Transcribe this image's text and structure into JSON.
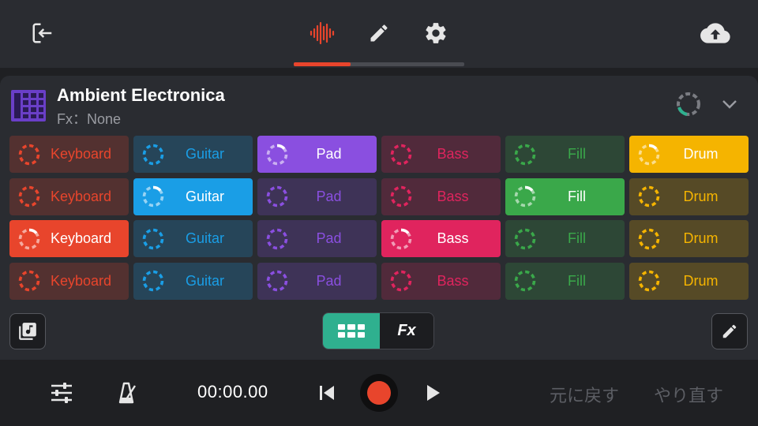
{
  "colors": {
    "accent": "#e8452c",
    "teal": "#2fb08f",
    "purple": "#6a3fc8"
  },
  "icons": {
    "exit": "exit-icon",
    "waveform": "waveform-icon",
    "edit_tab": "pencil-icon",
    "settings": "gear-icon",
    "upload": "cloud-upload-icon",
    "song": "grid-song-icon",
    "loop_status": "loop-progress-icon",
    "collapse": "chevron-down-icon",
    "library": "music-library-icon",
    "pad_grid": "pad-grid-icon",
    "edit": "pencil-icon",
    "mixer": "sliders-icon",
    "metronome": "metronome-icon",
    "rewind": "skip-start-icon",
    "record": "record-icon",
    "play": "play-icon"
  },
  "song": {
    "title": "Ambient Electronica",
    "fx_label": "Fx：None"
  },
  "columns": [
    {
      "name": "Keyboard",
      "color": "#e8452c"
    },
    {
      "name": "Guitar",
      "color": "#1a9ee6"
    },
    {
      "name": "Pad",
      "color": "#8a4fe0"
    },
    {
      "name": "Bass",
      "color": "#e0245e"
    },
    {
      "name": "Fill",
      "color": "#3aa84a"
    },
    {
      "name": "Drum",
      "color": "#f5b400"
    }
  ],
  "pads": [
    [
      "Keyboard",
      "Guitar",
      "Pad",
      "Bass",
      "Fill",
      "Drum"
    ],
    [
      "Keyboard",
      "Guitar",
      "Pad",
      "Bass",
      "Fill",
      "Drum"
    ],
    [
      "Keyboard",
      "Guitar",
      "Pad",
      "Bass",
      "Fill",
      "Drum"
    ],
    [
      "Keyboard",
      "Guitar",
      "Pad",
      "Bass",
      "Fill",
      "Drum"
    ]
  ],
  "active_rows_by_column": [
    2,
    1,
    0,
    2,
    1,
    0
  ],
  "segmented": {
    "fx_label": "Fx"
  },
  "transport": {
    "time": "00:00.00",
    "undo": "元に戻す",
    "redo": "やり直す"
  }
}
